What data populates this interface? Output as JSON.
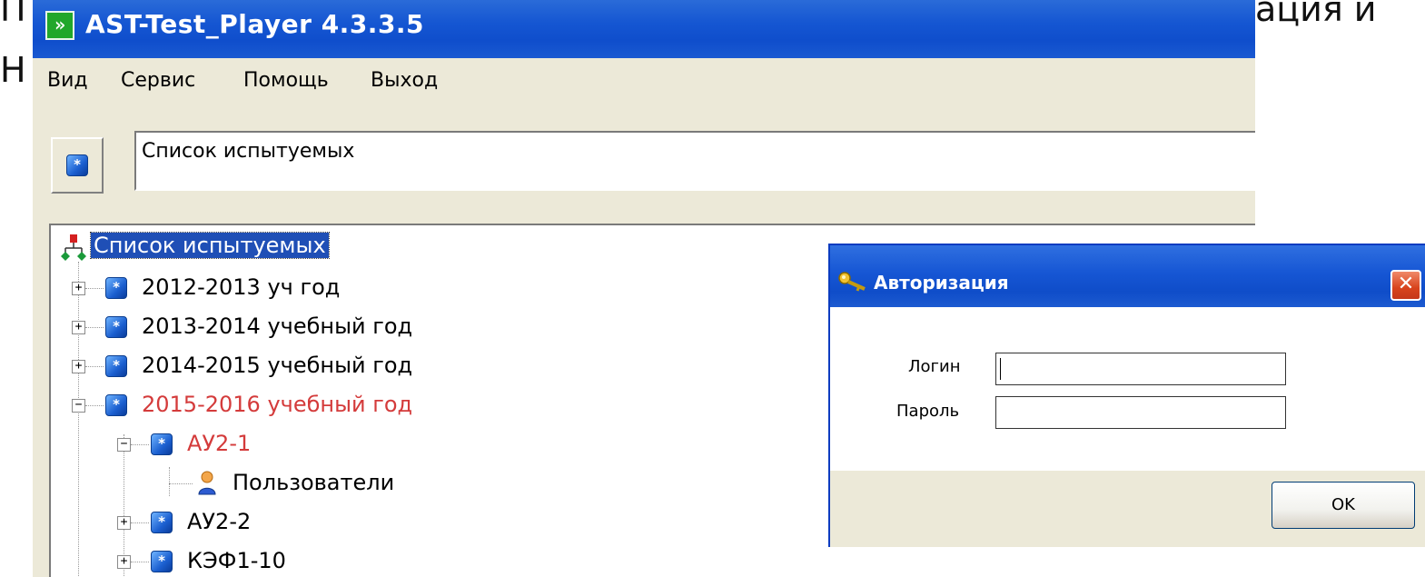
{
  "slide": {
    "line1_left": "П",
    "line1_right": "ация и",
    "line2": "Н"
  },
  "app": {
    "icon_glyph": "»",
    "title": "AST-Test_Player  4.3.3.5",
    "menu": [
      "Вид",
      "Сервис",
      "Помощь",
      "Выход"
    ],
    "address": "Список испытуемых"
  },
  "tree": {
    "root": "Список испытуемых",
    "items": [
      {
        "label": "2012-2013 уч год",
        "expander": "+"
      },
      {
        "label": "2013-2014 учебный год",
        "expander": "+"
      },
      {
        "label": "2014-2015 учебный год",
        "expander": "+"
      },
      {
        "label": "2015-2016 учебный год",
        "expander": "−"
      },
      {
        "label": "АУ2-1",
        "expander": "−"
      },
      {
        "label": "Пользователи"
      },
      {
        "label": "АУ2-2",
        "expander": "+"
      },
      {
        "label": "КЭФ1-10",
        "expander": "+"
      }
    ]
  },
  "dialog": {
    "title": "Авторизация",
    "close_glyph": "✕",
    "login_label": "Логин",
    "login_value": "",
    "password_label": "Пароль",
    "password_value": "",
    "ok_label": "OK"
  },
  "colors": {
    "title_blue": "#0f4ecc",
    "selected_red": "#d43b3b",
    "selection": "#1f4fb6",
    "window_bg": "#ece9d8"
  }
}
